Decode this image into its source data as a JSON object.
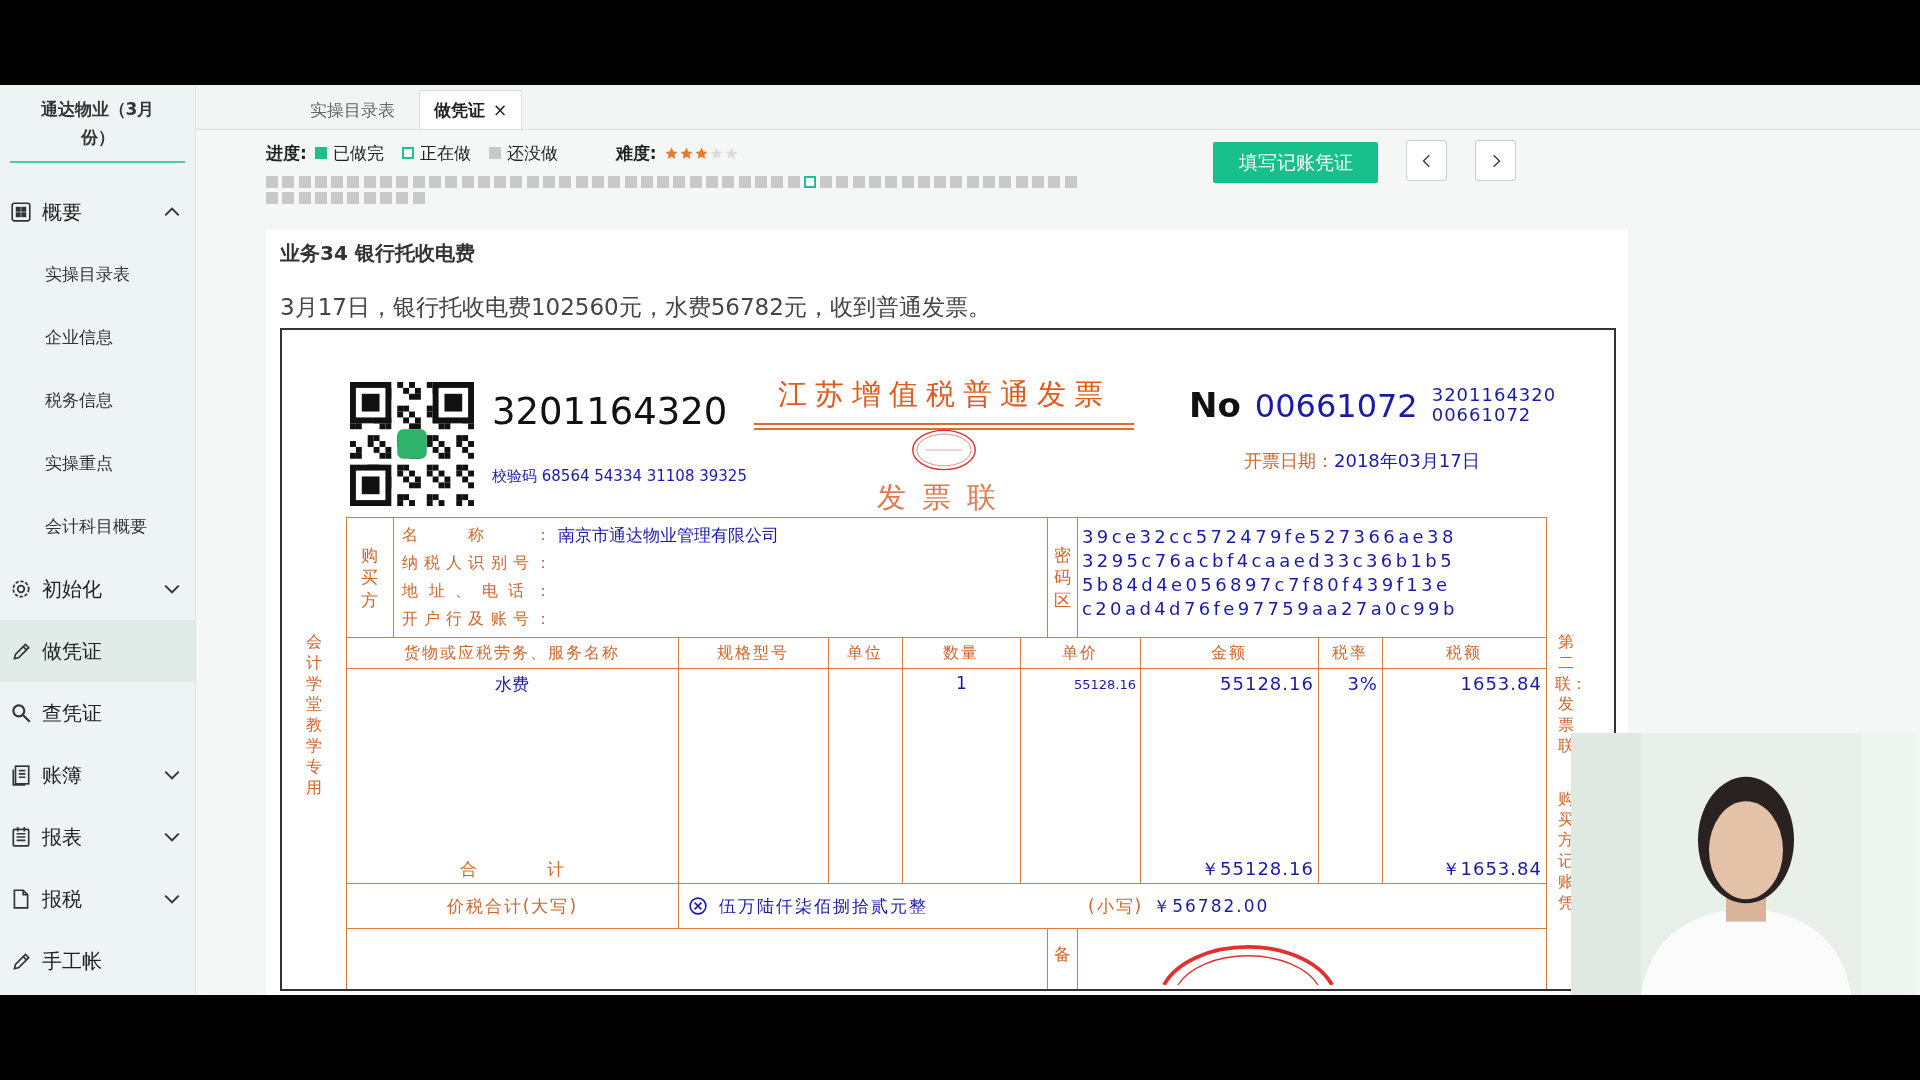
{
  "sidebar": {
    "title": "通达物业（3月份）",
    "items": [
      {
        "label": "概要",
        "expanded": true,
        "selected": false,
        "children": [
          {
            "label": "实操目录表"
          },
          {
            "label": "企业信息"
          },
          {
            "label": "税务信息"
          },
          {
            "label": "实操重点"
          },
          {
            "label": "会计科目概要"
          }
        ]
      },
      {
        "label": "初始化",
        "expanded": false,
        "selected": false
      },
      {
        "label": "做凭证",
        "selected": true
      },
      {
        "label": "查凭证",
        "selected": false
      },
      {
        "label": "账簿",
        "expanded": false,
        "selected": false
      },
      {
        "label": "报表",
        "expanded": false,
        "selected": false
      },
      {
        "label": "报税",
        "expanded": false,
        "selected": false
      },
      {
        "label": "手工帐",
        "selected": false
      }
    ]
  },
  "tabs": [
    {
      "label": "实操目录表",
      "selected": false
    },
    {
      "label": "做凭证",
      "selected": true,
      "close": "×"
    }
  ],
  "progress": {
    "label": "进度:",
    "legend": [
      {
        "label": "已做完",
        "kind": "done"
      },
      {
        "label": "正在做",
        "kind": "doing"
      },
      {
        "label": "还没做",
        "kind": "todo"
      }
    ],
    "difficulty_label": "难度:",
    "stars": 3,
    "tasks": [
      {
        "current": false
      },
      {
        "current": false
      },
      {
        "current": false
      },
      {
        "current": false
      },
      {
        "current": false
      },
      {
        "current": false
      },
      {
        "current": false
      },
      {
        "current": false
      },
      {
        "current": false
      },
      {
        "current": false
      },
      {
        "current": false
      },
      {
        "current": false
      },
      {
        "current": false
      },
      {
        "current": false
      },
      {
        "current": false
      },
      {
        "current": false
      },
      {
        "current": false
      },
      {
        "current": false
      },
      {
        "current": false
      },
      {
        "current": false
      },
      {
        "current": false
      },
      {
        "current": false
      },
      {
        "current": false
      },
      {
        "current": false
      },
      {
        "current": false
      },
      {
        "current": false
      },
      {
        "current": false
      },
      {
        "current": false
      },
      {
        "current": false
      },
      {
        "current": false
      },
      {
        "current": false
      },
      {
        "current": false
      },
      {
        "current": false
      },
      {
        "current": true
      },
      {
        "current": false
      },
      {
        "current": false
      },
      {
        "current": false
      },
      {
        "current": false
      },
      {
        "current": false
      },
      {
        "current": false
      },
      {
        "current": false
      },
      {
        "current": false
      },
      {
        "current": false
      },
      {
        "current": false
      },
      {
        "current": false
      },
      {
        "current": false
      },
      {
        "current": false
      },
      {
        "current": false
      },
      {
        "current": false
      },
      {
        "current": false
      },
      {
        "current": false
      },
      {
        "current": false
      },
      {
        "current": false
      },
      {
        "current": false
      },
      {
        "current": false
      },
      {
        "current": false
      },
      {
        "current": false
      },
      {
        "current": false
      },
      {
        "current": false
      },
      {
        "current": false
      }
    ]
  },
  "primary_button": "填写记账凭证",
  "task": {
    "title": "业务34 银行托收电费",
    "description": "3月17日，银行托收电费102560元，水费56782元，收到普通发票。"
  },
  "invoice": {
    "code": "3201164320",
    "title": "江苏增值税普通发票",
    "copy": "发票联",
    "no_label": "No",
    "number": "00661072",
    "small_code": "3201164320",
    "small_number": "00661072",
    "check_code": "校验码 68564 54334 31108 39325",
    "date_label": "开票日期：",
    "date": "2018年03月17日",
    "left_side": "会计学堂教学专用",
    "right_side_1": "第二联：发票联",
    "right_side_2": "购买方记账凭",
    "buyer_label": "购买方",
    "buyer_fields": [
      {
        "label": "名称：",
        "value": "南京市通达物业管理有限公司"
      },
      {
        "label": "纳税人识别号："
      },
      {
        "label": "地址、电话："
      },
      {
        "label": "开户行及账号："
      }
    ],
    "cipher_label": "密码区",
    "cipher": [
      "39ce32cc572479fe527366ae38",
      "3295c76acbf4caaed33c36b1b5",
      "5b84d4e056897c7f80f439f13e",
      "c20ad4d76fe97759aa27a0c99b"
    ],
    "columns": [
      "货物或应税劳务、服务名称",
      "规格型号",
      "单位",
      "数量",
      "单价",
      "金额",
      "税率",
      "税额"
    ],
    "items": [
      {
        "name": "水费",
        "qty": "1",
        "price": "55128.16",
        "amount": "55128.16",
        "rate": "3%",
        "tax": "1653.84"
      }
    ],
    "total_label": "合计",
    "total_amount": "￥55128.16",
    "total_tax": "￥1653.84",
    "sum_label": "价税合计(大写)",
    "sum_words": "伍万陆仟柒佰捌拾贰元整",
    "sum_small_label": "(小写)",
    "sum_small": "￥56782.00",
    "remarks_label": "备"
  }
}
